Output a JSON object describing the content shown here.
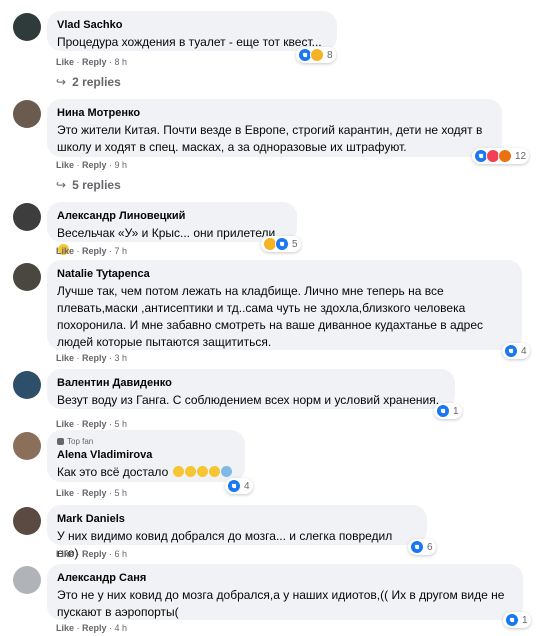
{
  "comments": [
    {
      "author": "Vlad Sachko",
      "text": "Процедура хождения в туалет - еще тот квест...",
      "actions": {
        "like": "Like",
        "reply": "Reply",
        "time": "8 h"
      },
      "reaction_count": "8",
      "reactions": [
        "like-icon",
        "laugh-icon"
      ],
      "replies": "2 replies"
    },
    {
      "author": "Нина Мотренко",
      "text": "Это жители Китая. Почти везде в Европе, строгий карантин, дети не ходят в школу и ходят в спец. масках, а за одноразовые их штрафуют.",
      "actions": {
        "like": "Like",
        "reply": "Reply",
        "time": "9 h"
      },
      "reaction_count": "12",
      "reactions": [
        "like-icon",
        "love-icon",
        "angry-icon"
      ],
      "replies": "5 replies"
    },
    {
      "author": "Александр Линовецкий",
      "text": "Весельчак «У» и Крыс... они прилетели",
      "actions": {
        "like": "Like",
        "reply": "Reply",
        "time": "7 h"
      },
      "reaction_count": "5",
      "reactions": [
        "laugh-icon",
        "like-icon"
      ]
    },
    {
      "author": "Natalie Tytapenca",
      "text": "Лучше так, чем потом лежать на кладбище. Лично мне теперь на все плевать,маски ,антисептики и тд..сама чуть не здохла,близкого человека похоронила. И мне забавно смотреть на ваше диванное кудахтанье в адрес людей которые пытаются защититься.",
      "actions": {
        "like": "Like",
        "reply": "Reply",
        "time": "3 h"
      },
      "reaction_count": "4",
      "reactions": [
        "like-icon"
      ]
    },
    {
      "author": "Валентин Давиденко",
      "text": "Везут воду из Ганга. С соблюдением всех норм и условий хранения.",
      "actions": {
        "like": "Like",
        "reply": "Reply",
        "time": "5 h"
      },
      "reaction_count": "1",
      "reactions": [
        "like-icon"
      ]
    },
    {
      "author": "Alena Vladimirova",
      "badge": "Top fan",
      "text": "Как это всё достало",
      "actions": {
        "like": "Like",
        "reply": "Reply",
        "time": "5 h"
      },
      "reaction_count": "4",
      "reactions": [
        "like-icon"
      ]
    },
    {
      "author": "Mark Daniels",
      "text": "У них видимо ковид добрался до мозга... и слегка повредил его)",
      "actions": {
        "like": "Like",
        "reply": "Reply",
        "time": "6 h"
      },
      "reaction_count": "6",
      "reactions": [
        "like-icon"
      ]
    },
    {
      "author": "Александр Саня",
      "text": "Это не у них ковид до мозга добрался,а у наших идиотов,(( Их в другом виде не пускают в аэропорты(",
      "actions": {
        "like": "Like",
        "reply": "Reply",
        "time": "4 h"
      },
      "reaction_count": "1",
      "reactions": [
        "like-icon"
      ]
    }
  ],
  "colors": {
    "bubble": "#f0f2f5",
    "meta": "#65676b",
    "like": "#1877f2"
  }
}
